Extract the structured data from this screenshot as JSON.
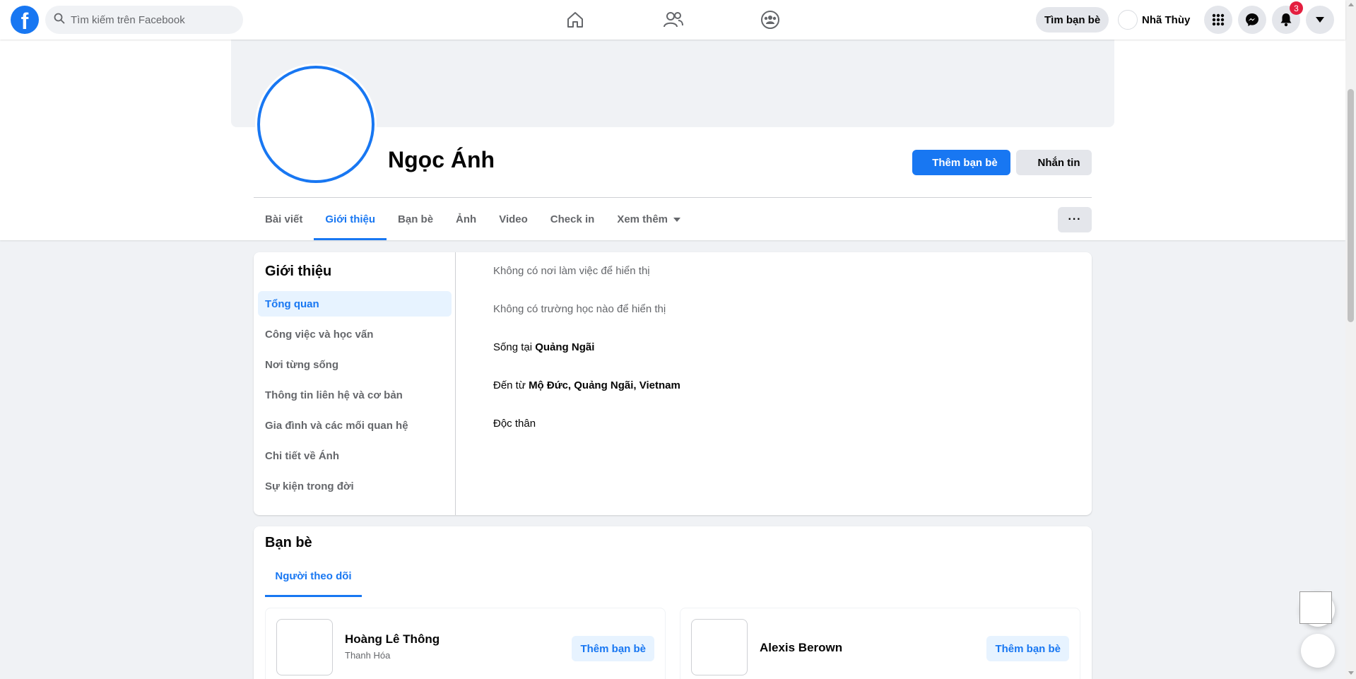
{
  "topbar": {
    "search_placeholder": "Tìm kiếm trên Facebook",
    "find_friends_label": "Tìm bạn bè",
    "user_name": "Nhã Thùy",
    "notification_count": "3",
    "icons": [
      "facebook-logo-icon",
      "search-icon",
      "home-icon",
      "friends-icon",
      "groups-icon",
      "menu-grid-icon",
      "messenger-icon",
      "bell-icon",
      "caret-down-icon"
    ]
  },
  "profile": {
    "name": "Ngọc Ánh",
    "add_friend_label": "Thêm bạn bè",
    "message_label": "Nhắn tin",
    "more_label": "···"
  },
  "tabs": [
    {
      "label": "Bài viết"
    },
    {
      "label": "Giới thiệu",
      "active": true
    },
    {
      "label": "Bạn bè"
    },
    {
      "label": "Ảnh"
    },
    {
      "label": "Video"
    },
    {
      "label": "Check in"
    },
    {
      "label": "Xem thêm"
    }
  ],
  "about": {
    "title": "Giới thiệu",
    "menu": [
      {
        "label": "Tổng quan",
        "active": true
      },
      {
        "label": "Công việc và học vấn"
      },
      {
        "label": "Nơi từng sống"
      },
      {
        "label": "Thông tin liên hệ và cơ bản"
      },
      {
        "label": "Gia đình và các mối quan hệ"
      },
      {
        "label": "Chi tiết về Ánh"
      },
      {
        "label": "Sự kiện trong đời"
      }
    ],
    "work": "Không có nơi làm việc để hiển thị",
    "school": "Không có trường học nào để hiển thị",
    "lives_prefix": "Sống tại ",
    "lives_value": "Quảng Ngãi",
    "from_prefix": "Đến từ ",
    "from_value": "Mộ Đức, Quảng Ngãi, Vietnam",
    "relationship": "Độc thân"
  },
  "friends": {
    "title": "Bạn bè",
    "followers_tab": "Người theo dõi",
    "items": [
      {
        "name": "Hoàng Lê Thông",
        "location": "Thanh Hóa",
        "button": "Thêm bạn bè"
      },
      {
        "name": "Alexis Berown",
        "location": "",
        "button": "Thêm bạn bè"
      }
    ]
  },
  "colors": {
    "brand": "#1877f2",
    "badge": "#e41e3f",
    "page_bg": "#f0f2f5"
  }
}
